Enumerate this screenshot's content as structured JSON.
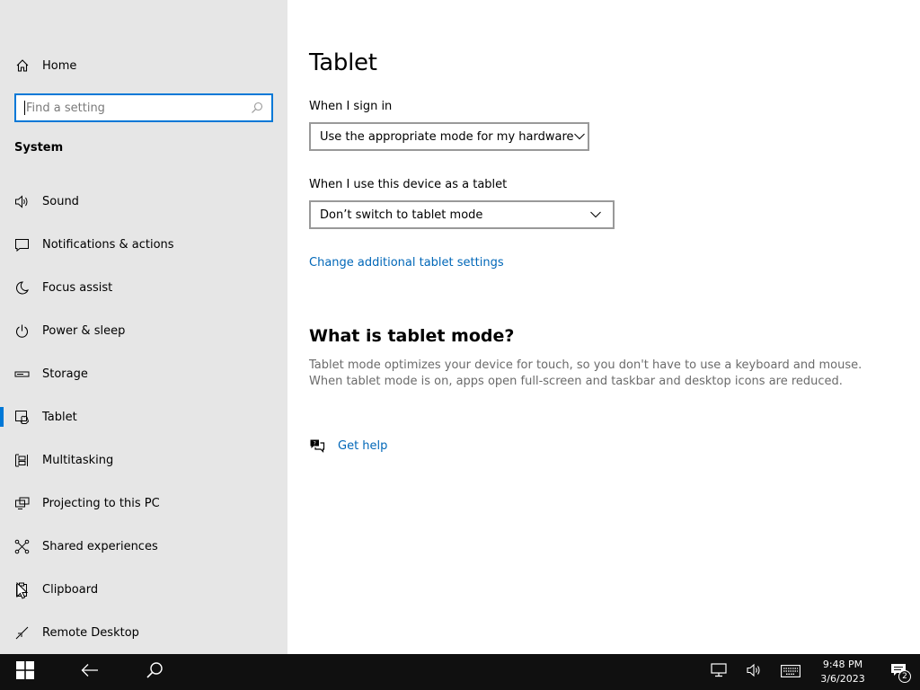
{
  "sidebar": {
    "home_label": "Home",
    "search_placeholder": "Find a setting",
    "section_title": "System",
    "items": [
      {
        "label": "Sound",
        "icon": "speaker-icon"
      },
      {
        "label": "Notifications & actions",
        "icon": "notification-icon"
      },
      {
        "label": "Focus assist",
        "icon": "moon-icon"
      },
      {
        "label": "Power & sleep",
        "icon": "power-icon"
      },
      {
        "label": "Storage",
        "icon": "storage-icon"
      },
      {
        "label": "Tablet",
        "icon": "tablet-icon",
        "selected": true
      },
      {
        "label": "Multitasking",
        "icon": "multitasking-icon"
      },
      {
        "label": "Projecting to this PC",
        "icon": "projecting-icon"
      },
      {
        "label": "Shared experiences",
        "icon": "shared-experiences-icon"
      },
      {
        "label": "Clipboard",
        "icon": "clipboard-icon"
      },
      {
        "label": "Remote Desktop",
        "icon": "remote-desktop-icon"
      }
    ]
  },
  "main": {
    "title": "Tablet",
    "sign_in_label": "When I sign in",
    "sign_in_value": "Use the appropriate mode for my hardware",
    "tablet_label": "When I use this device as a tablet",
    "tablet_value": "Don’t switch to tablet mode",
    "additional_link": "Change additional tablet settings",
    "what_heading": "What is tablet mode?",
    "what_description": "Tablet mode optimizes your device for touch, so you don't have to use a keyboard and mouse. When tablet mode is on, apps open full-screen and taskbar and desktop icons are reduced.",
    "help_label": "Get help"
  },
  "taskbar": {
    "time": "9:48 PM",
    "date": "3/6/2023",
    "notification_count": "2"
  },
  "colors": {
    "accent": "#0078d7",
    "link": "#0067b8",
    "sidebar_bg": "#e6e6e6",
    "taskbar_bg": "#101010"
  }
}
